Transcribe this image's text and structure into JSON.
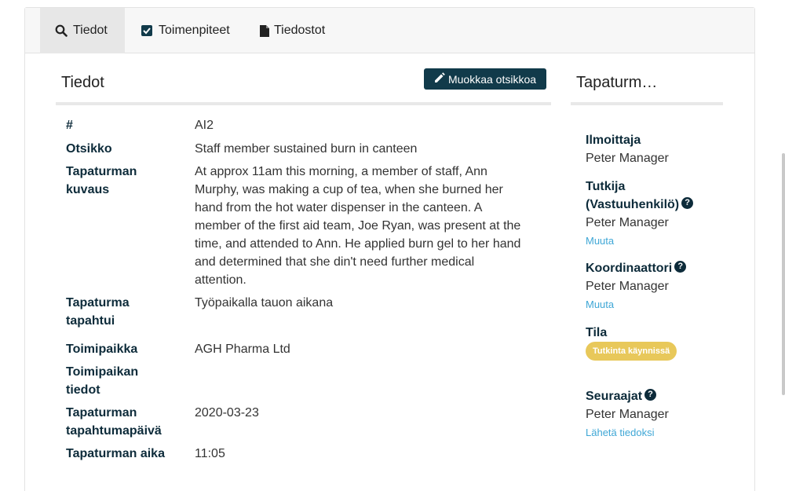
{
  "tabs": [
    {
      "label": "Tiedot",
      "icon": "search-icon"
    },
    {
      "label": "Toimenpiteet",
      "icon": "check-square-icon"
    },
    {
      "label": "Tiedostot",
      "icon": "file-icon"
    }
  ],
  "details": {
    "title": "Tiedot",
    "edit_button": "Muokkaa otsikkoa",
    "fields": [
      {
        "label": "#",
        "value": "AI2"
      },
      {
        "label": "Otsikko",
        "value": "Staff member sustained burn in canteen"
      },
      {
        "label": "Tapaturman kuvaus",
        "value": "At approx 11am this morning, a member of staff, Ann Murphy, was making a cup of tea, when she burned her hand from the hot water dispenser in the canteen. A member of the first aid team, Joe Ryan, was present at the time, and attended to Ann. He applied burn gel to her hand and determined that she din't need further medical attention."
      },
      {
        "label": "Tapaturma tapahtui",
        "value": "Työpaikalla tauon aikana"
      },
      {
        "label": "Toimipaikka",
        "value": "AGH Pharma Ltd"
      },
      {
        "label": "Toimipaikan tiedot",
        "value": ""
      },
      {
        "label": "Tapaturman tapahtumapäivä",
        "value": "2020-03-23"
      },
      {
        "label": "Tapaturman aika",
        "value": "11:05"
      }
    ]
  },
  "sidebar": {
    "title": "Tapaturm…",
    "reporter_label": "Ilmoittaja",
    "reporter_value": "Peter Manager",
    "investigator_label": "Tutkija (Vastuuhenkilö)",
    "investigator_value": "Peter Manager",
    "investigator_link": "Muuta",
    "coordinator_label": "Koordinaattori",
    "coordinator_value": "Peter Manager",
    "coordinator_link": "Muuta",
    "status_label": "Tila",
    "status_badge": "Tutkinta käynnissä",
    "followers_label": "Seuraajat",
    "followers_value": "Peter Manager",
    "followers_link": "Lähetä tiedoksi"
  },
  "colors": {
    "dark_navy": "#0d2b3a",
    "button_bg": "#113a4a",
    "link": "#3fa7d6",
    "badge": "#e8c85a"
  }
}
